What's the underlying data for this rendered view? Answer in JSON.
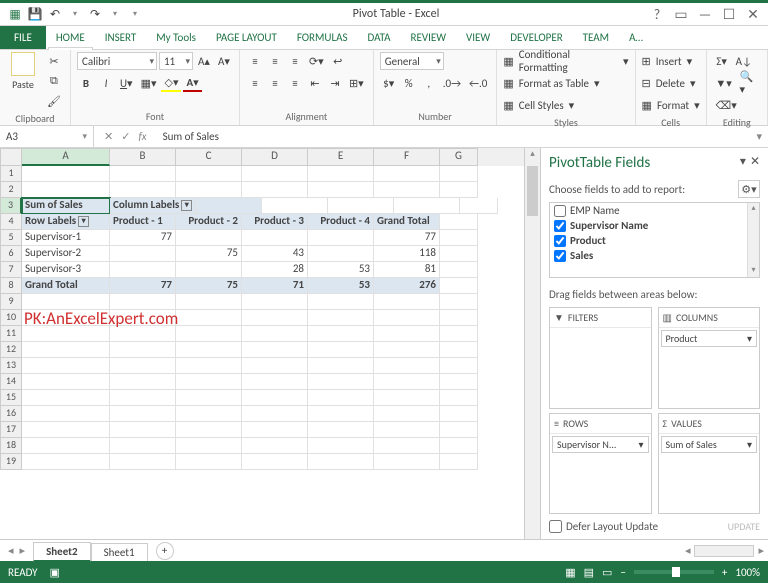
{
  "app": {
    "title": "Pivot Table - Excel"
  },
  "qat": {
    "save": "💾",
    "undo": "↶",
    "redo": "↷"
  },
  "tabs": [
    "FILE",
    "HOME",
    "INSERT",
    "My Tools",
    "PAGE LAYOUT",
    "FORMULAS",
    "DATA",
    "REVIEW",
    "VIEW",
    "DEVELOPER",
    "TEAM",
    "A…"
  ],
  "activeTab": 1,
  "ribbon": {
    "clipboard": {
      "label": "Clipboard",
      "paste": "Paste"
    },
    "font": {
      "label": "Font",
      "name": "Calibri",
      "size": "11"
    },
    "alignment": {
      "label": "Alignment"
    },
    "number": {
      "label": "Number",
      "format": "General"
    },
    "styles": {
      "label": "Styles",
      "cf": "Conditional Formatting",
      "tbl": "Format as Table",
      "cs": "Cell Styles"
    },
    "cells": {
      "label": "Cells",
      "ins": "Insert",
      "del": "Delete",
      "fmt": "Format"
    },
    "editing": {
      "label": "Editing"
    }
  },
  "namebox": "A3",
  "formula": "Sum of Sales",
  "columns": [
    "A",
    "B",
    "C",
    "D",
    "E",
    "F",
    "G"
  ],
  "selectedCol": 0,
  "grid": {
    "r3": {
      "A": "Sum of Sales",
      "B": "Column Labels"
    },
    "r4": {
      "A": "Row Labels",
      "B": "Product - 1",
      "C": "Product - 2",
      "D": "Product - 3",
      "E": "Product - 4",
      "F": "Grand Total"
    },
    "r5": {
      "A": "Supervisor-1",
      "B": "77",
      "F": "77"
    },
    "r6": {
      "A": "Supervisor-2",
      "C": "75",
      "D": "43",
      "F": "118"
    },
    "r7": {
      "A": "Supervisor-3",
      "D": "28",
      "E": "53",
      "F": "81"
    },
    "r8": {
      "A": "Grand Total",
      "B": "77",
      "C": "75",
      "D": "71",
      "E": "53",
      "F": "276"
    }
  },
  "chart_data": {
    "type": "table",
    "title": "Sum of Sales",
    "row_field": "Supervisor Name",
    "col_field": "Product",
    "value_field": "Sales",
    "columns": [
      "Product - 1",
      "Product - 2",
      "Product - 3",
      "Product - 4",
      "Grand Total"
    ],
    "rows": [
      {
        "label": "Supervisor-1",
        "values": [
          77,
          null,
          null,
          null,
          77
        ]
      },
      {
        "label": "Supervisor-2",
        "values": [
          null,
          75,
          43,
          null,
          118
        ]
      },
      {
        "label": "Supervisor-3",
        "values": [
          null,
          null,
          28,
          53,
          81
        ]
      },
      {
        "label": "Grand Total",
        "values": [
          77,
          75,
          71,
          53,
          276
        ]
      }
    ]
  },
  "watermark": "PK:AnExcelExpert.com",
  "pane": {
    "title": "PivotTable Fields",
    "choose": "Choose fields to add to report:",
    "fields": [
      {
        "name": "EMP Name",
        "checked": false
      },
      {
        "name": "Supervisor Name",
        "checked": true
      },
      {
        "name": "Product",
        "checked": true
      },
      {
        "name": "Sales",
        "checked": true
      }
    ],
    "drag": "Drag fields between areas below:",
    "filters": {
      "label": "FILTERS"
    },
    "columns": {
      "label": "COLUMNS",
      "item": "Product"
    },
    "rows": {
      "label": "ROWS",
      "item": "Supervisor N..."
    },
    "values": {
      "label": "VALUES",
      "item": "Sum of Sales"
    },
    "defer": "Defer Layout Update",
    "update": "UPDATE"
  },
  "sheets": {
    "s1": "Sheet2",
    "s2": "Sheet1"
  },
  "status": {
    "ready": "READY",
    "zoom": "100%"
  }
}
